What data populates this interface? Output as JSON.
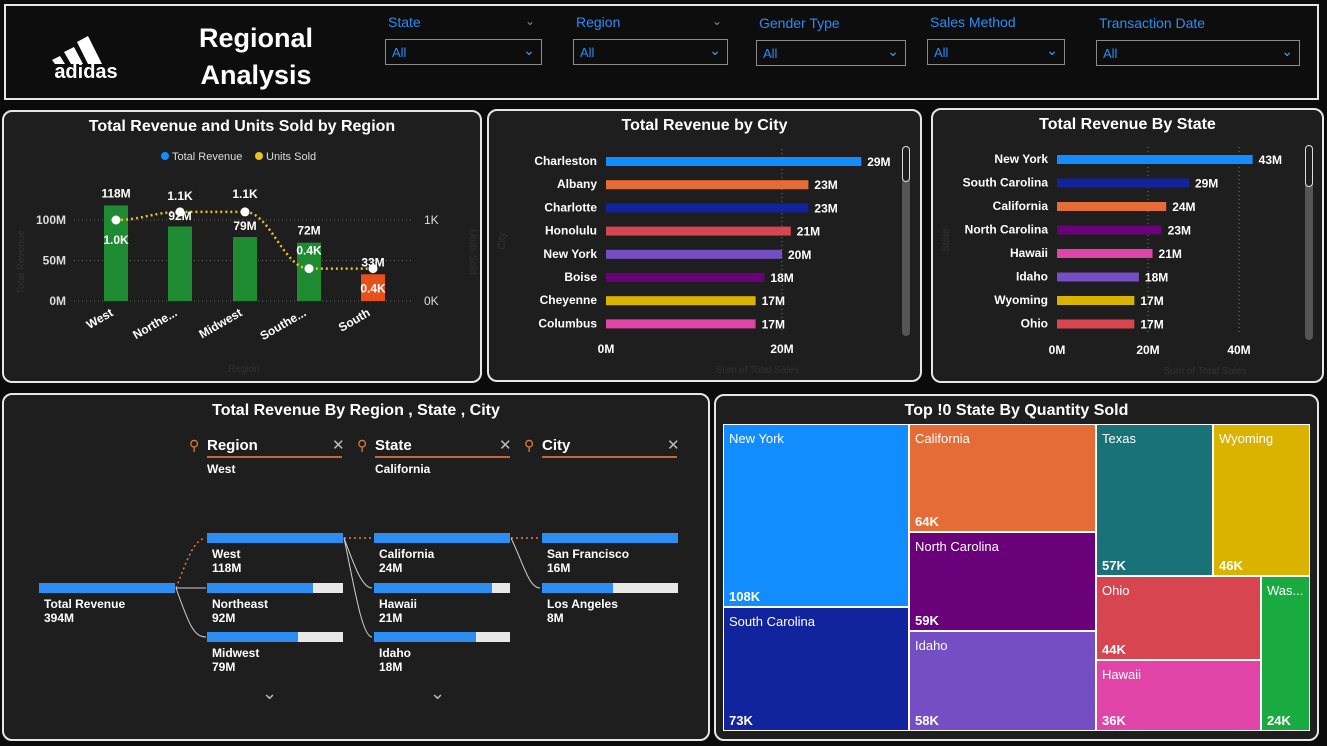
{
  "header": {
    "brand": "adidas",
    "title_line1": "Regional",
    "title_line2": "Analysis",
    "slicers": [
      {
        "label": "State",
        "value": "All"
      },
      {
        "label": "Region",
        "value": "All"
      },
      {
        "label": "Gender Type",
        "value": "All"
      },
      {
        "label": "Sales Method",
        "value": "All"
      },
      {
        "label": "Transaction Date",
        "value": "All"
      }
    ]
  },
  "region_chart": {
    "title": "Total Revenue and Units Sold by Region",
    "legend": [
      "Total Revenue",
      "Units Sold"
    ],
    "y_ticks_left": [
      "100M",
      "50M",
      "0M"
    ],
    "y_ticks_right": [
      "1K",
      "0K"
    ],
    "ylabel_left": "Total Revenue",
    "ylabel_right": "Units Sold",
    "xlabel": "Region",
    "categories": [
      "West",
      "Northe...",
      "Midwest",
      "Southe...",
      "South"
    ],
    "bar_labels": [
      "118M",
      "92M",
      "79M",
      "72M",
      "33M"
    ],
    "line_labels": [
      "1.0K",
      "1.1K",
      "1.1K",
      "0.4K",
      "0.4K"
    ]
  },
  "city_chart": {
    "title": "Total Revenue by City",
    "ylabel": "City",
    "xlabel": "Sum of Total Sales",
    "x_ticks": [
      "0M",
      "20M"
    ],
    "labels": [
      "29M",
      "23M",
      "23M",
      "21M",
      "20M",
      "18M",
      "17M",
      "17M"
    ]
  },
  "state_chart": {
    "title": "Total Revenue By State",
    "ylabel": "State",
    "xlabel": "Sum of Total Sales",
    "x_ticks": [
      "0M",
      "20M",
      "40M"
    ],
    "labels": [
      "43M",
      "29M",
      "24M",
      "23M",
      "21M",
      "18M",
      "17M",
      "17M"
    ]
  },
  "decomp": {
    "title": "Total Revenue By Region , State , City",
    "levels": [
      {
        "name": "Region",
        "selected": "West"
      },
      {
        "name": "State",
        "selected": "California"
      },
      {
        "name": "City",
        "selected": ""
      }
    ],
    "root": {
      "label": "Total Revenue",
      "value": "394M"
    },
    "col1": [
      {
        "label": "West",
        "value": "118M",
        "fill": 1.0
      },
      {
        "label": "Northeast",
        "value": "92M",
        "fill": 0.78
      },
      {
        "label": "Midwest",
        "value": "79M",
        "fill": 0.67
      }
    ],
    "col2": [
      {
        "label": "California",
        "value": "24M",
        "fill": 1.0
      },
      {
        "label": "Hawaii",
        "value": "21M",
        "fill": 0.87
      },
      {
        "label": "Idaho",
        "value": "18M",
        "fill": 0.75
      }
    ],
    "col3": [
      {
        "label": "San Francisco",
        "value": "16M",
        "fill": 1.0
      },
      {
        "label": "Los Angeles",
        "value": "8M",
        "fill": 0.52
      }
    ]
  },
  "treemap": {
    "title": "Top !0 State By Quantity Sold",
    "cells": [
      {
        "name": "New York",
        "value": "108K",
        "color": "#118dff"
      },
      {
        "name": "South Carolina",
        "value": "73K",
        "color": "#12239e"
      },
      {
        "name": "California",
        "value": "64K",
        "color": "#e66c37"
      },
      {
        "name": "North Carolina",
        "value": "59K",
        "color": "#6b007b"
      },
      {
        "name": "Idaho",
        "value": "58K",
        "color": "#744ec2"
      },
      {
        "name": "Texas",
        "value": "57K",
        "color": "#197278"
      },
      {
        "name": "Wyoming",
        "value": "46K",
        "color": "#d9b300"
      },
      {
        "name": "Ohio",
        "value": "44K",
        "color": "#d64550"
      },
      {
        "name": "Hawaii",
        "value": "36K",
        "color": "#e044a7"
      },
      {
        "name": "Was...",
        "value": "24K",
        "color": "#1aab40"
      }
    ]
  },
  "chart_data": [
    {
      "type": "bar",
      "title": "Total Revenue and Units Sold by Region",
      "categories": [
        "West",
        "Northeast",
        "Midwest",
        "Southeast",
        "South"
      ],
      "series": [
        {
          "name": "Total Revenue",
          "values": [
            118,
            92,
            79,
            72,
            33
          ],
          "unit": "M",
          "colors": [
            "#1e8b33",
            "#1e8b33",
            "#1e8b33",
            "#1e8b33",
            "#e5501b"
          ]
        },
        {
          "name": "Units Sold",
          "values": [
            1.0,
            1.1,
            1.1,
            0.4,
            0.4
          ],
          "unit": "K",
          "axis": "right",
          "color": "#e6c229"
        }
      ],
      "xlabel": "Region",
      "ylabel": "Total Revenue",
      "ylim": [
        0,
        120
      ]
    },
    {
      "type": "bar",
      "orientation": "horizontal",
      "title": "Total Revenue by City",
      "categories": [
        "Charleston",
        "Albany",
        "Charlotte",
        "Honolulu",
        "New York",
        "Boise",
        "Cheyenne",
        "Columbus"
      ],
      "values": [
        29,
        23,
        23,
        21,
        20,
        18,
        17,
        17
      ],
      "colors": [
        "#118dff",
        "#e66c37",
        "#12239e",
        "#d64550",
        "#744ec2",
        "#6b007b",
        "#d9b300",
        "#e044a7"
      ],
      "unit": "M",
      "xlabel": "Sum of Total Sales",
      "ylabel": "City",
      "xlim": [
        0,
        30
      ]
    },
    {
      "type": "bar",
      "orientation": "horizontal",
      "title": "Total Revenue By State",
      "categories": [
        "New York",
        "South Carolina",
        "California",
        "North Carolina",
        "Hawaii",
        "Idaho",
        "Wyoming",
        "Ohio"
      ],
      "values": [
        43,
        29,
        24,
        23,
        21,
        18,
        17,
        17
      ],
      "colors": [
        "#118dff",
        "#12239e",
        "#e66c37",
        "#6b007b",
        "#e044a7",
        "#744ec2",
        "#d9b300",
        "#d64550"
      ],
      "unit": "M",
      "xlabel": "Sum of Total Sales",
      "ylabel": "State",
      "xlim": [
        0,
        45
      ]
    },
    {
      "type": "treemap",
      "title": "Top !0 State By Quantity Sold",
      "categories": [
        "New York",
        "South Carolina",
        "California",
        "North Carolina",
        "Idaho",
        "Texas",
        "Wyoming",
        "Ohio",
        "Hawaii",
        "Washington"
      ],
      "values": [
        108,
        73,
        64,
        59,
        58,
        57,
        46,
        44,
        36,
        24
      ],
      "unit": "K"
    }
  ]
}
